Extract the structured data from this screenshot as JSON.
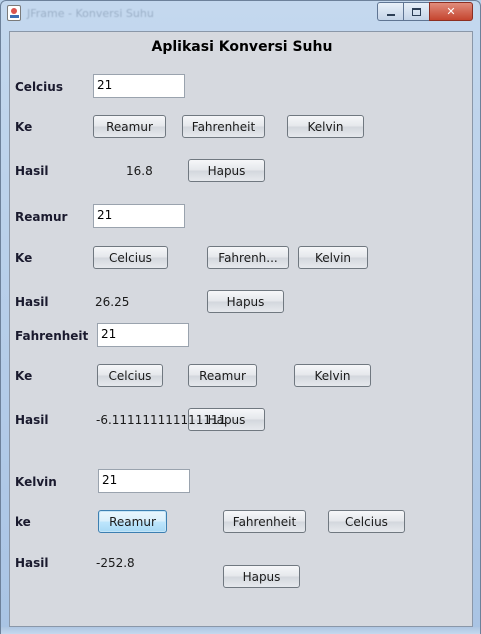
{
  "window": {
    "title": "JFrame - Konversi Suhu",
    "heading": "Aplikasi Konversi Suhu"
  },
  "celcius": {
    "label": "Celcius",
    "input_value": "21",
    "ke_label": "Ke",
    "buttons": {
      "reamur": "Reamur",
      "fahrenheit": "Fahrenheit",
      "kelvin": "Kelvin"
    },
    "hasil_label": "Hasil",
    "hasil_value": "16.8",
    "hapus": "Hapus"
  },
  "reamur": {
    "label": "Reamur",
    "input_value": "21",
    "ke_label": "Ke",
    "buttons": {
      "celcius": "Celcius",
      "fahrenheit": "Fahrenh...",
      "kelvin": "Kelvin"
    },
    "hasil_label": "Hasil",
    "hasil_value": "26.25",
    "hapus": "Hapus"
  },
  "fahrenheit": {
    "label": "Fahrenheit",
    "input_value": "21",
    "ke_label": "Ke",
    "buttons": {
      "celcius": "Celcius",
      "reamur": "Reamur",
      "kelvin": "Kelvin"
    },
    "hasil_label": "Hasil",
    "hasil_value": "-6.111111111111111",
    "hapus": "Hapus"
  },
  "kelvin": {
    "label": "Kelvin",
    "input_value": "21",
    "ke_label": "ke",
    "buttons": {
      "reamur": "Reamur",
      "fahrenheit": "Fahrenheit",
      "celcius": "Celcius"
    },
    "hasil_label": "Hasil",
    "hasil_value": "-252.8",
    "hapus": "Hapus"
  }
}
